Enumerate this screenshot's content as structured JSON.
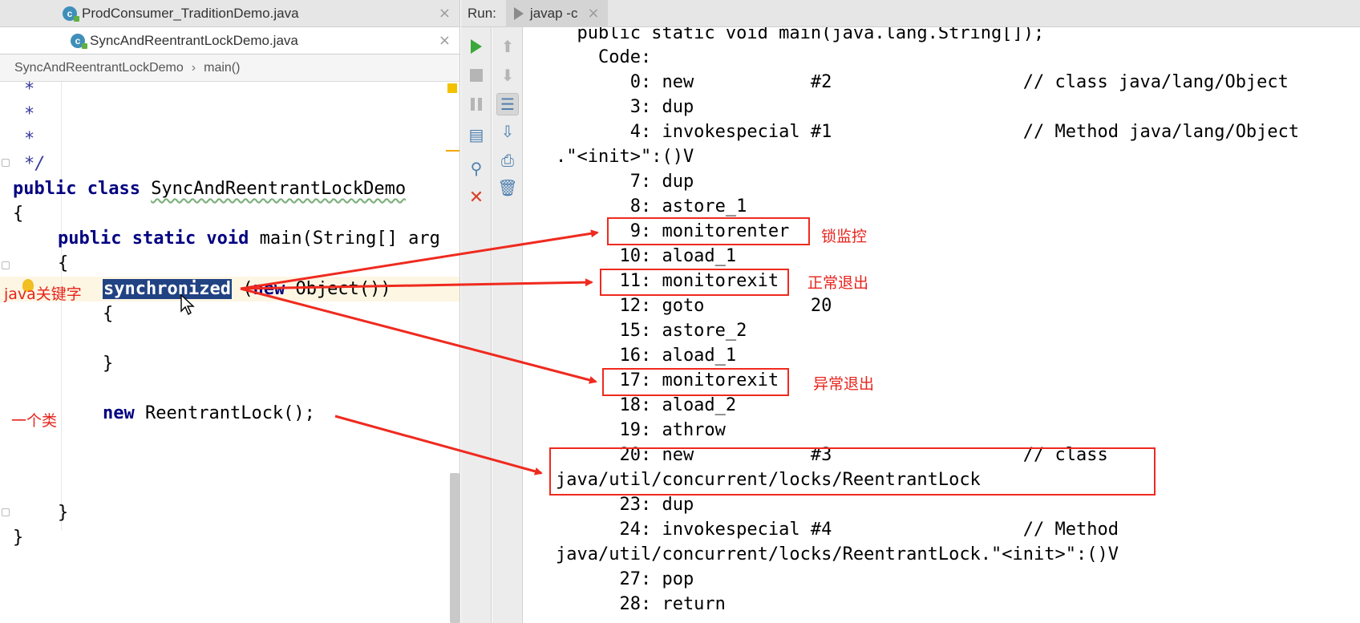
{
  "editor": {
    "tabs": [
      {
        "label": "ProdConsumer_TraditionDemo.java",
        "icon": "java-class-icon",
        "close": "×"
      },
      {
        "label": "SyncAndReentrantLockDemo.java",
        "icon": "java-class-icon",
        "close": "×"
      }
    ],
    "breadcrumb": {
      "class": "SyncAndReentrantLockDemo",
      "separator": "›",
      "method": "main()"
    },
    "code": {
      "c1": "*",
      "c2": "*",
      "c3": "*",
      "c4": "*/",
      "public_class": "public class ",
      "class_name": "SyncAndReentrantLockDemo",
      "brace_open": "{",
      "main_kw": "public static void ",
      "main_rest": "main(String[] arg",
      "inner_brace_open": "{",
      "sync_kw": "synchronized",
      "sync_rest_a": " (",
      "sync_new": "new",
      "sync_rest_b": " Object())",
      "block_open": "{",
      "block_close": "}",
      "new_kw": "new",
      "new_rest": " ReentrantLock();",
      "inner_brace_close": "}",
      "brace_close": "}"
    }
  },
  "run": {
    "label": "Run:",
    "tab_label": "javap -c",
    "tab_close": "×"
  },
  "output": {
    "lines": [
      "  public static void main(java.lang.String[]);",
      "    Code:",
      "       0: new           #2                  // class java/lang/Object",
      "       3: dup",
      "       4: invokespecial #1                  // Method java/lang/Object",
      ".\"<init>\":()V",
      "       7: dup",
      "       8: astore_1",
      "       9: monitorenter",
      "      10: aload_1",
      "      11: monitorexit",
      "      12: goto          20",
      "      15: astore_2",
      "      16: aload_1",
      "      17: monitorexit",
      "      18: aload_2",
      "      19: athrow",
      "      20: new           #3                  // class",
      "java/util/concurrent/locks/ReentrantLock",
      "      23: dup",
      "      24: invokespecial #4                  // Method",
      "java/util/concurrent/locks/ReentrantLock.\"<init>\":()V",
      "      27: pop",
      "      28: return"
    ]
  },
  "annotations": {
    "lock_monitor": "锁监控",
    "normal_exit": "正常退出",
    "exception_exit": "异常退出",
    "java_keyword": "java关键字",
    "a_class": "一个类"
  },
  "colors": {
    "annotation_red": "#e8231c",
    "keyword_blue": "#000080",
    "selection": "#214283"
  }
}
